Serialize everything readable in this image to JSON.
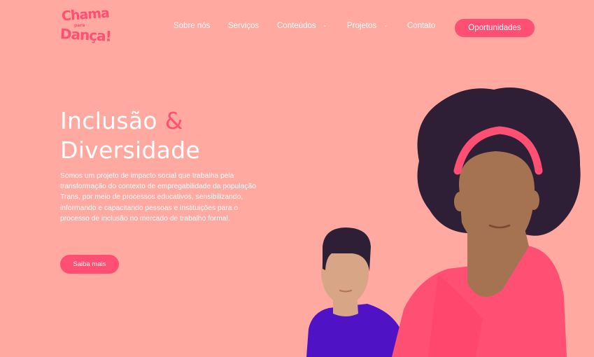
{
  "logo": {
    "line1": "Chama",
    "line2": "para",
    "line3": "Dança!"
  },
  "nav": {
    "items": [
      {
        "label": "Sobre nós",
        "has_dropdown": false
      },
      {
        "label": "Serviços",
        "has_dropdown": false
      },
      {
        "label": "Conteúdos",
        "has_dropdown": true
      },
      {
        "label": "Projetos",
        "has_dropdown": true
      },
      {
        "label": "Contato",
        "has_dropdown": false
      }
    ],
    "cta": "Oportunidades"
  },
  "hero": {
    "title_word1": "Inclusão",
    "title_amp": "&",
    "title_word2": "Diversidade",
    "description": "Somos um projeto de impacto social que trabalha pela transformação do contexto de empregabilidade da população Trans, por meio de processos educativos, sensibilizando, informando e capacitando pessoas e instituições para o processo de inclusão no mercado de trabalho formal.",
    "button": "Saiba mais"
  },
  "colors": {
    "background": "#ffa9a0",
    "accent": "#ff4f73",
    "text": "#ffffff",
    "hair": "#2e1f37",
    "skin_woman": "#a57352",
    "skin_man": "#d9a587",
    "shirt_man": "#4f12c4",
    "jacket_woman": "#ff4f73"
  }
}
